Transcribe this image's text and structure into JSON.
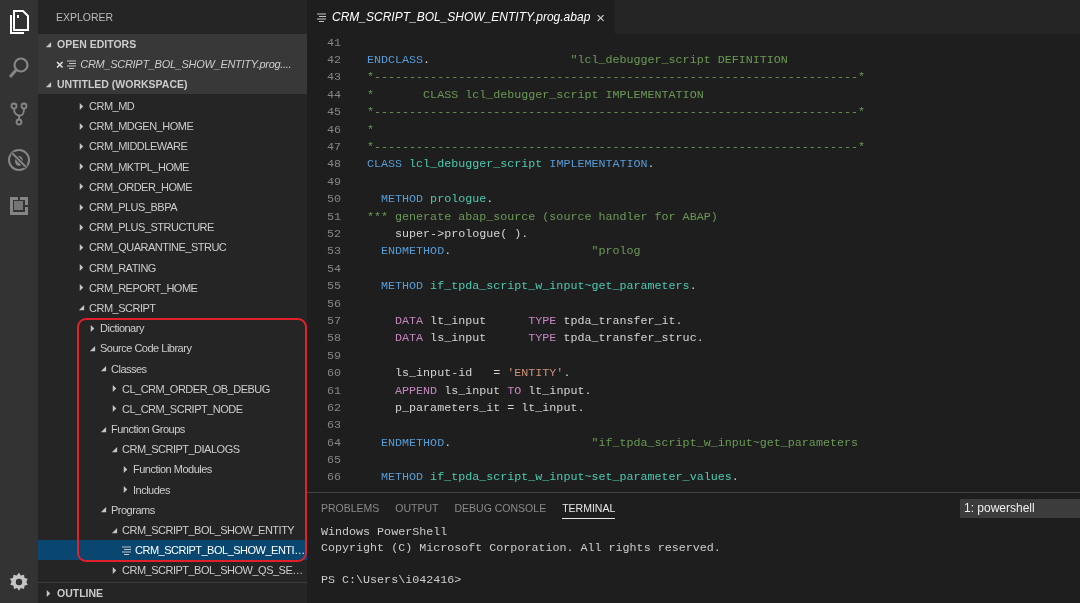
{
  "activity_bar": {
    "items": [
      {
        "kind": "files",
        "selected": true
      },
      {
        "kind": "search",
        "selected": false
      },
      {
        "kind": "source-control",
        "selected": false
      },
      {
        "kind": "debug",
        "selected": false
      },
      {
        "kind": "extensions",
        "selected": false
      }
    ]
  },
  "sidebar": {
    "title": "EXPLORER",
    "open_editors": {
      "title": "OPEN EDITORS",
      "expanded": true,
      "items": [
        {
          "close": "×",
          "name": "CRM_SCRIPT_BOL_SHOW_ENTITY.prog...."
        }
      ]
    },
    "workspace": {
      "title": "UNTITLED (WORKSPACE)",
      "expanded": true,
      "tree": [
        {
          "label": "CRM_MD",
          "kind": "folder",
          "expanded": false,
          "selected": false
        },
        {
          "label": "CRM_MDGEN_HOME",
          "kind": "folder",
          "expanded": false,
          "selected": false
        },
        {
          "label": "CRM_MIDDLEWARE",
          "kind": "folder",
          "expanded": false,
          "selected": false
        },
        {
          "label": "CRM_MKTPL_HOME",
          "kind": "folder",
          "expanded": false,
          "selected": false
        },
        {
          "label": "CRM_ORDER_HOME",
          "kind": "folder",
          "expanded": false,
          "selected": false
        },
        {
          "label": "CRM_PLUS_BBPA",
          "kind": "folder",
          "expanded": false,
          "selected": false
        },
        {
          "label": "CRM_PLUS_STRUCTURE",
          "kind": "folder",
          "expanded": false,
          "selected": false
        },
        {
          "label": "CRM_QUARANTINE_STRUC",
          "kind": "folder",
          "expanded": false,
          "selected": false
        },
        {
          "label": "CRM_RATING",
          "kind": "folder",
          "expanded": false,
          "selected": false
        },
        {
          "label": "CRM_REPORT_HOME",
          "kind": "folder",
          "expanded": false,
          "selected": false
        },
        {
          "label": "CRM_SCRIPT",
          "kind": "folder",
          "expanded": true,
          "selected": false,
          "children": [
            {
              "label": "Dictionary",
              "kind": "folder",
              "expanded": false,
              "selected": false
            },
            {
              "label": "Source Code Library",
              "kind": "folder",
              "expanded": true,
              "selected": false,
              "children": [
                {
                  "label": "Classes",
                  "kind": "folder",
                  "expanded": true,
                  "selected": false,
                  "children": [
                    {
                      "label": "CL_CRM_ORDER_OB_DEBUG",
                      "kind": "folder",
                      "expanded": false,
                      "selected": false
                    },
                    {
                      "label": "CL_CRM_SCRIPT_NODE",
                      "kind": "folder",
                      "expanded": false,
                      "selected": false
                    }
                  ]
                },
                {
                  "label": "Function Groups",
                  "kind": "folder",
                  "expanded": true,
                  "selected": false,
                  "children": [
                    {
                      "label": "CRM_SCRIPT_DIALOGS",
                      "kind": "folder",
                      "expanded": true,
                      "selected": false,
                      "children": [
                        {
                          "label": "Function Modules",
                          "kind": "folder",
                          "expanded": false,
                          "selected": false
                        },
                        {
                          "label": "Includes",
                          "kind": "folder",
                          "expanded": false,
                          "selected": false
                        }
                      ]
                    }
                  ]
                },
                {
                  "label": "Programs",
                  "kind": "folder",
                  "expanded": true,
                  "selected": false,
                  "children": [
                    {
                      "label": "CRM_SCRIPT_BOL_SHOW_ENTITY",
                      "kind": "folder",
                      "expanded": true,
                      "selected": false,
                      "children": [
                        {
                          "label": "CRM_SCRIPT_BOL_SHOW_ENTI…",
                          "kind": "file",
                          "selected": true
                        }
                      ]
                    },
                    {
                      "label": "CRM_SCRIPT_BOL_SHOW_QS_SE…",
                      "kind": "folder",
                      "expanded": false,
                      "selected": false
                    }
                  ]
                }
              ]
            }
          ]
        }
      ]
    },
    "outline": {
      "title": "OUTLINE",
      "expanded": false
    }
  },
  "editor": {
    "tabs": [
      {
        "label": "CRM_SCRIPT_BOL_SHOW_ENTITY.prog.abap",
        "close": "×",
        "selected": true
      }
    ],
    "lines": [
      {
        "n": "41"
      },
      {
        "n": "42",
        "tokens": [
          {
            "kind": "keyword",
            "text": "ENDCLASS"
          },
          {
            "kind": "plain",
            "text": "."
          },
          {
            "kind": "comment",
            "text": "                    \"lcl_debugger_script DEFINITION"
          }
        ]
      },
      {
        "n": "43",
        "tokens": [
          {
            "kind": "comment",
            "text": "*---------------------------------------------------------------------*"
          }
        ]
      },
      {
        "n": "44",
        "tokens": [
          {
            "kind": "comment",
            "text": "*       CLASS lcl_debugger_script IMPLEMENTATION"
          }
        ]
      },
      {
        "n": "45",
        "tokens": [
          {
            "kind": "comment",
            "text": "*---------------------------------------------------------------------*"
          }
        ]
      },
      {
        "n": "46",
        "tokens": [
          {
            "kind": "comment",
            "text": "*"
          }
        ]
      },
      {
        "n": "47",
        "tokens": [
          {
            "kind": "comment",
            "text": "*---------------------------------------------------------------------*"
          }
        ]
      },
      {
        "n": "48",
        "tokens": [
          {
            "kind": "keyword",
            "text": "CLASS"
          },
          {
            "kind": "name",
            "text": " lcl_debugger_script"
          },
          {
            "kind": "keyword",
            "text": " IMPLEMENTATION"
          },
          {
            "kind": "plain",
            "text": "."
          }
        ]
      },
      {
        "n": "49"
      },
      {
        "n": "50",
        "tokens": [
          {
            "kind": "keyword",
            "text": "  METHOD"
          },
          {
            "kind": "name",
            "text": " prologue"
          },
          {
            "kind": "plain",
            "text": "."
          }
        ]
      },
      {
        "n": "51",
        "tokens": [
          {
            "kind": "comment",
            "text": "*** generate abap_source (source handler for ABAP)"
          }
        ]
      },
      {
        "n": "52",
        "tokens": [
          {
            "kind": "plain",
            "text": "    super->prologue( )."
          }
        ]
      },
      {
        "n": "53",
        "tokens": [
          {
            "kind": "keyword",
            "text": "  ENDMETHOD"
          },
          {
            "kind": "plain",
            "text": "."
          },
          {
            "kind": "comment",
            "text": "                    \"prolog"
          }
        ]
      },
      {
        "n": "54"
      },
      {
        "n": "55",
        "tokens": [
          {
            "kind": "keyword",
            "text": "  METHOD"
          },
          {
            "kind": "name",
            "text": " if_tpda_script_w_input~get_parameters"
          },
          {
            "kind": "plain",
            "text": "."
          }
        ]
      },
      {
        "n": "56"
      },
      {
        "n": "57",
        "tokens": [
          {
            "kind": "control",
            "text": "    DATA"
          },
          {
            "kind": "plain",
            "text": " lt_input"
          },
          {
            "kind": "control",
            "text": "      TYPE"
          },
          {
            "kind": "plain",
            "text": " tpda_transfer_it."
          }
        ]
      },
      {
        "n": "58",
        "tokens": [
          {
            "kind": "control",
            "text": "    DATA"
          },
          {
            "kind": "plain",
            "text": " ls_input"
          },
          {
            "kind": "control",
            "text": "      TYPE"
          },
          {
            "kind": "plain",
            "text": " tpda_transfer_struc."
          }
        ]
      },
      {
        "n": "59"
      },
      {
        "n": "60",
        "tokens": [
          {
            "kind": "plain",
            "text": "    ls_input-id   ="
          },
          {
            "kind": "string",
            "text": " 'ENTITY'"
          },
          {
            "kind": "plain",
            "text": "."
          }
        ]
      },
      {
        "n": "61",
        "tokens": [
          {
            "kind": "control",
            "text": "    APPEND"
          },
          {
            "kind": "plain",
            "text": " ls_input"
          },
          {
            "kind": "control",
            "text": " TO"
          },
          {
            "kind": "plain",
            "text": " lt_input."
          }
        ]
      },
      {
        "n": "62",
        "tokens": [
          {
            "kind": "plain",
            "text": "    p_parameters_it = lt_input."
          }
        ]
      },
      {
        "n": "63"
      },
      {
        "n": "64",
        "tokens": [
          {
            "kind": "keyword",
            "text": "  ENDMETHOD"
          },
          {
            "kind": "plain",
            "text": "."
          },
          {
            "kind": "comment",
            "text": "                    \"if_tpda_script_w_input~get_parameters"
          }
        ]
      },
      {
        "n": "65"
      },
      {
        "n": "66",
        "tokens": [
          {
            "kind": "keyword",
            "text": "  METHOD"
          },
          {
            "kind": "name",
            "text": " if_tpda_script_w_input~set_parameter_values"
          },
          {
            "kind": "plain",
            "text": "."
          }
        ]
      }
    ]
  },
  "panel": {
    "tabs": [
      {
        "label": "PROBLEMS",
        "selected": false
      },
      {
        "label": "OUTPUT",
        "selected": false
      },
      {
        "label": "DEBUG CONSOLE",
        "selected": false
      },
      {
        "label": "TERMINAL",
        "selected": true
      }
    ],
    "terminal_select": "1: powershell",
    "terminal_lines": [
      {
        "kind": "output",
        "text": "Windows PowerShell"
      },
      {
        "kind": "output",
        "text": "Copyright (C) Microsoft Corporation. All rights reserved."
      },
      {
        "kind": "blank"
      },
      {
        "kind": "prompt",
        "text": "PS C:\\Users\\i042416>"
      }
    ]
  }
}
